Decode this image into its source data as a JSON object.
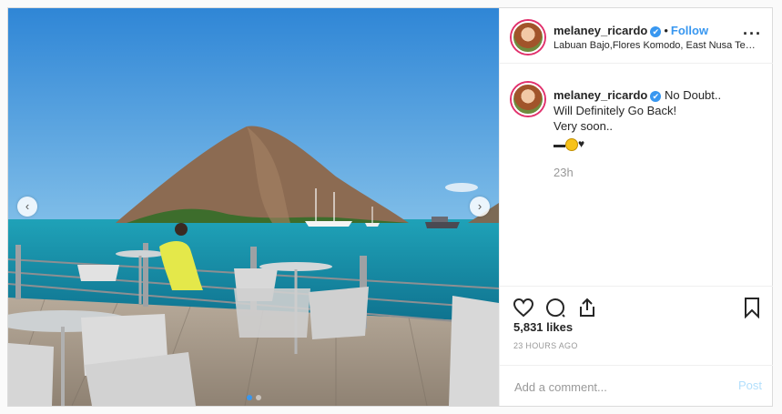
{
  "post": {
    "username": "melaney_ricardo",
    "verified_mark": "✔",
    "separator": "•",
    "follow_label": "Follow",
    "location": "Labuan Bajo,Flores Komodo, East Nusa Tenggara",
    "more_icon": "···",
    "caption_first": "No Doubt..",
    "caption_lines": [
      "Will Definitely Go Back!",
      "Very soon.."
    ],
    "heart_emoji": "♥",
    "time_ago": "23h",
    "likes": "5,831 likes",
    "posted_ago": "23 HOURS AGO",
    "comment_placeholder": "Add a comment...",
    "post_label": "Post"
  },
  "carousel": {
    "prev_icon": "‹",
    "next_icon": "›",
    "slide_count": 2,
    "active_slide": 1
  },
  "icons": {
    "like": "heart-icon",
    "comment": "comment-icon",
    "share": "share-icon",
    "save": "bookmark-icon"
  },
  "colors": {
    "accent": "#3897f0",
    "post_disabled": "#b2dffc",
    "text": "#262626",
    "muted": "#999999"
  }
}
